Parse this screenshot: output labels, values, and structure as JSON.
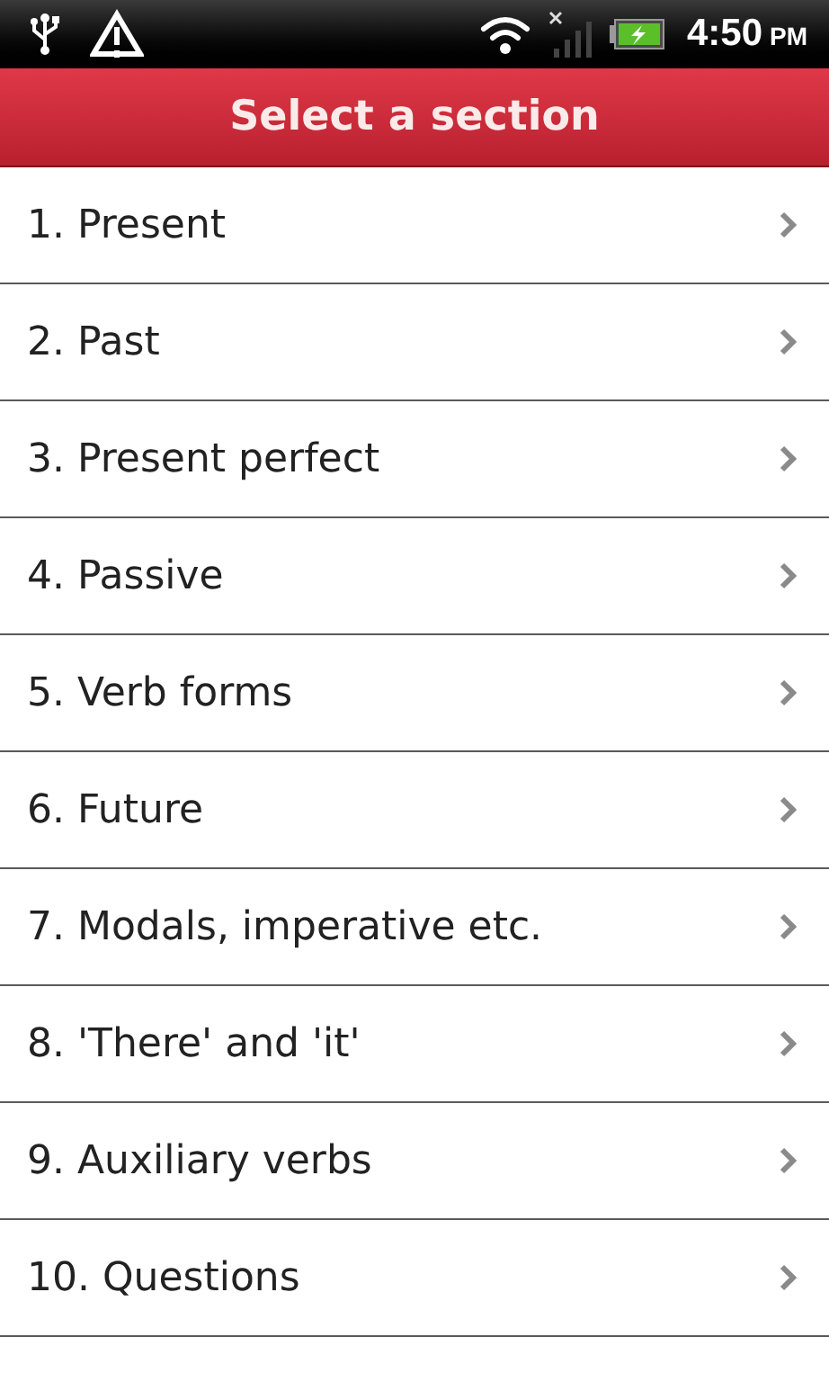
{
  "status_bar": {
    "time": "4:50",
    "meridiem": "PM"
  },
  "header": {
    "title": "Select a section"
  },
  "sections": [
    {
      "label": "1. Present"
    },
    {
      "label": "2. Past"
    },
    {
      "label": "3. Present perfect"
    },
    {
      "label": "4. Passive"
    },
    {
      "label": "5. Verb forms"
    },
    {
      "label": "6. Future"
    },
    {
      "label": "7. Modals, imperative etc."
    },
    {
      "label": "8. 'There' and 'it'"
    },
    {
      "label": "9. Auxiliary verbs"
    },
    {
      "label": "10. Questions"
    }
  ]
}
